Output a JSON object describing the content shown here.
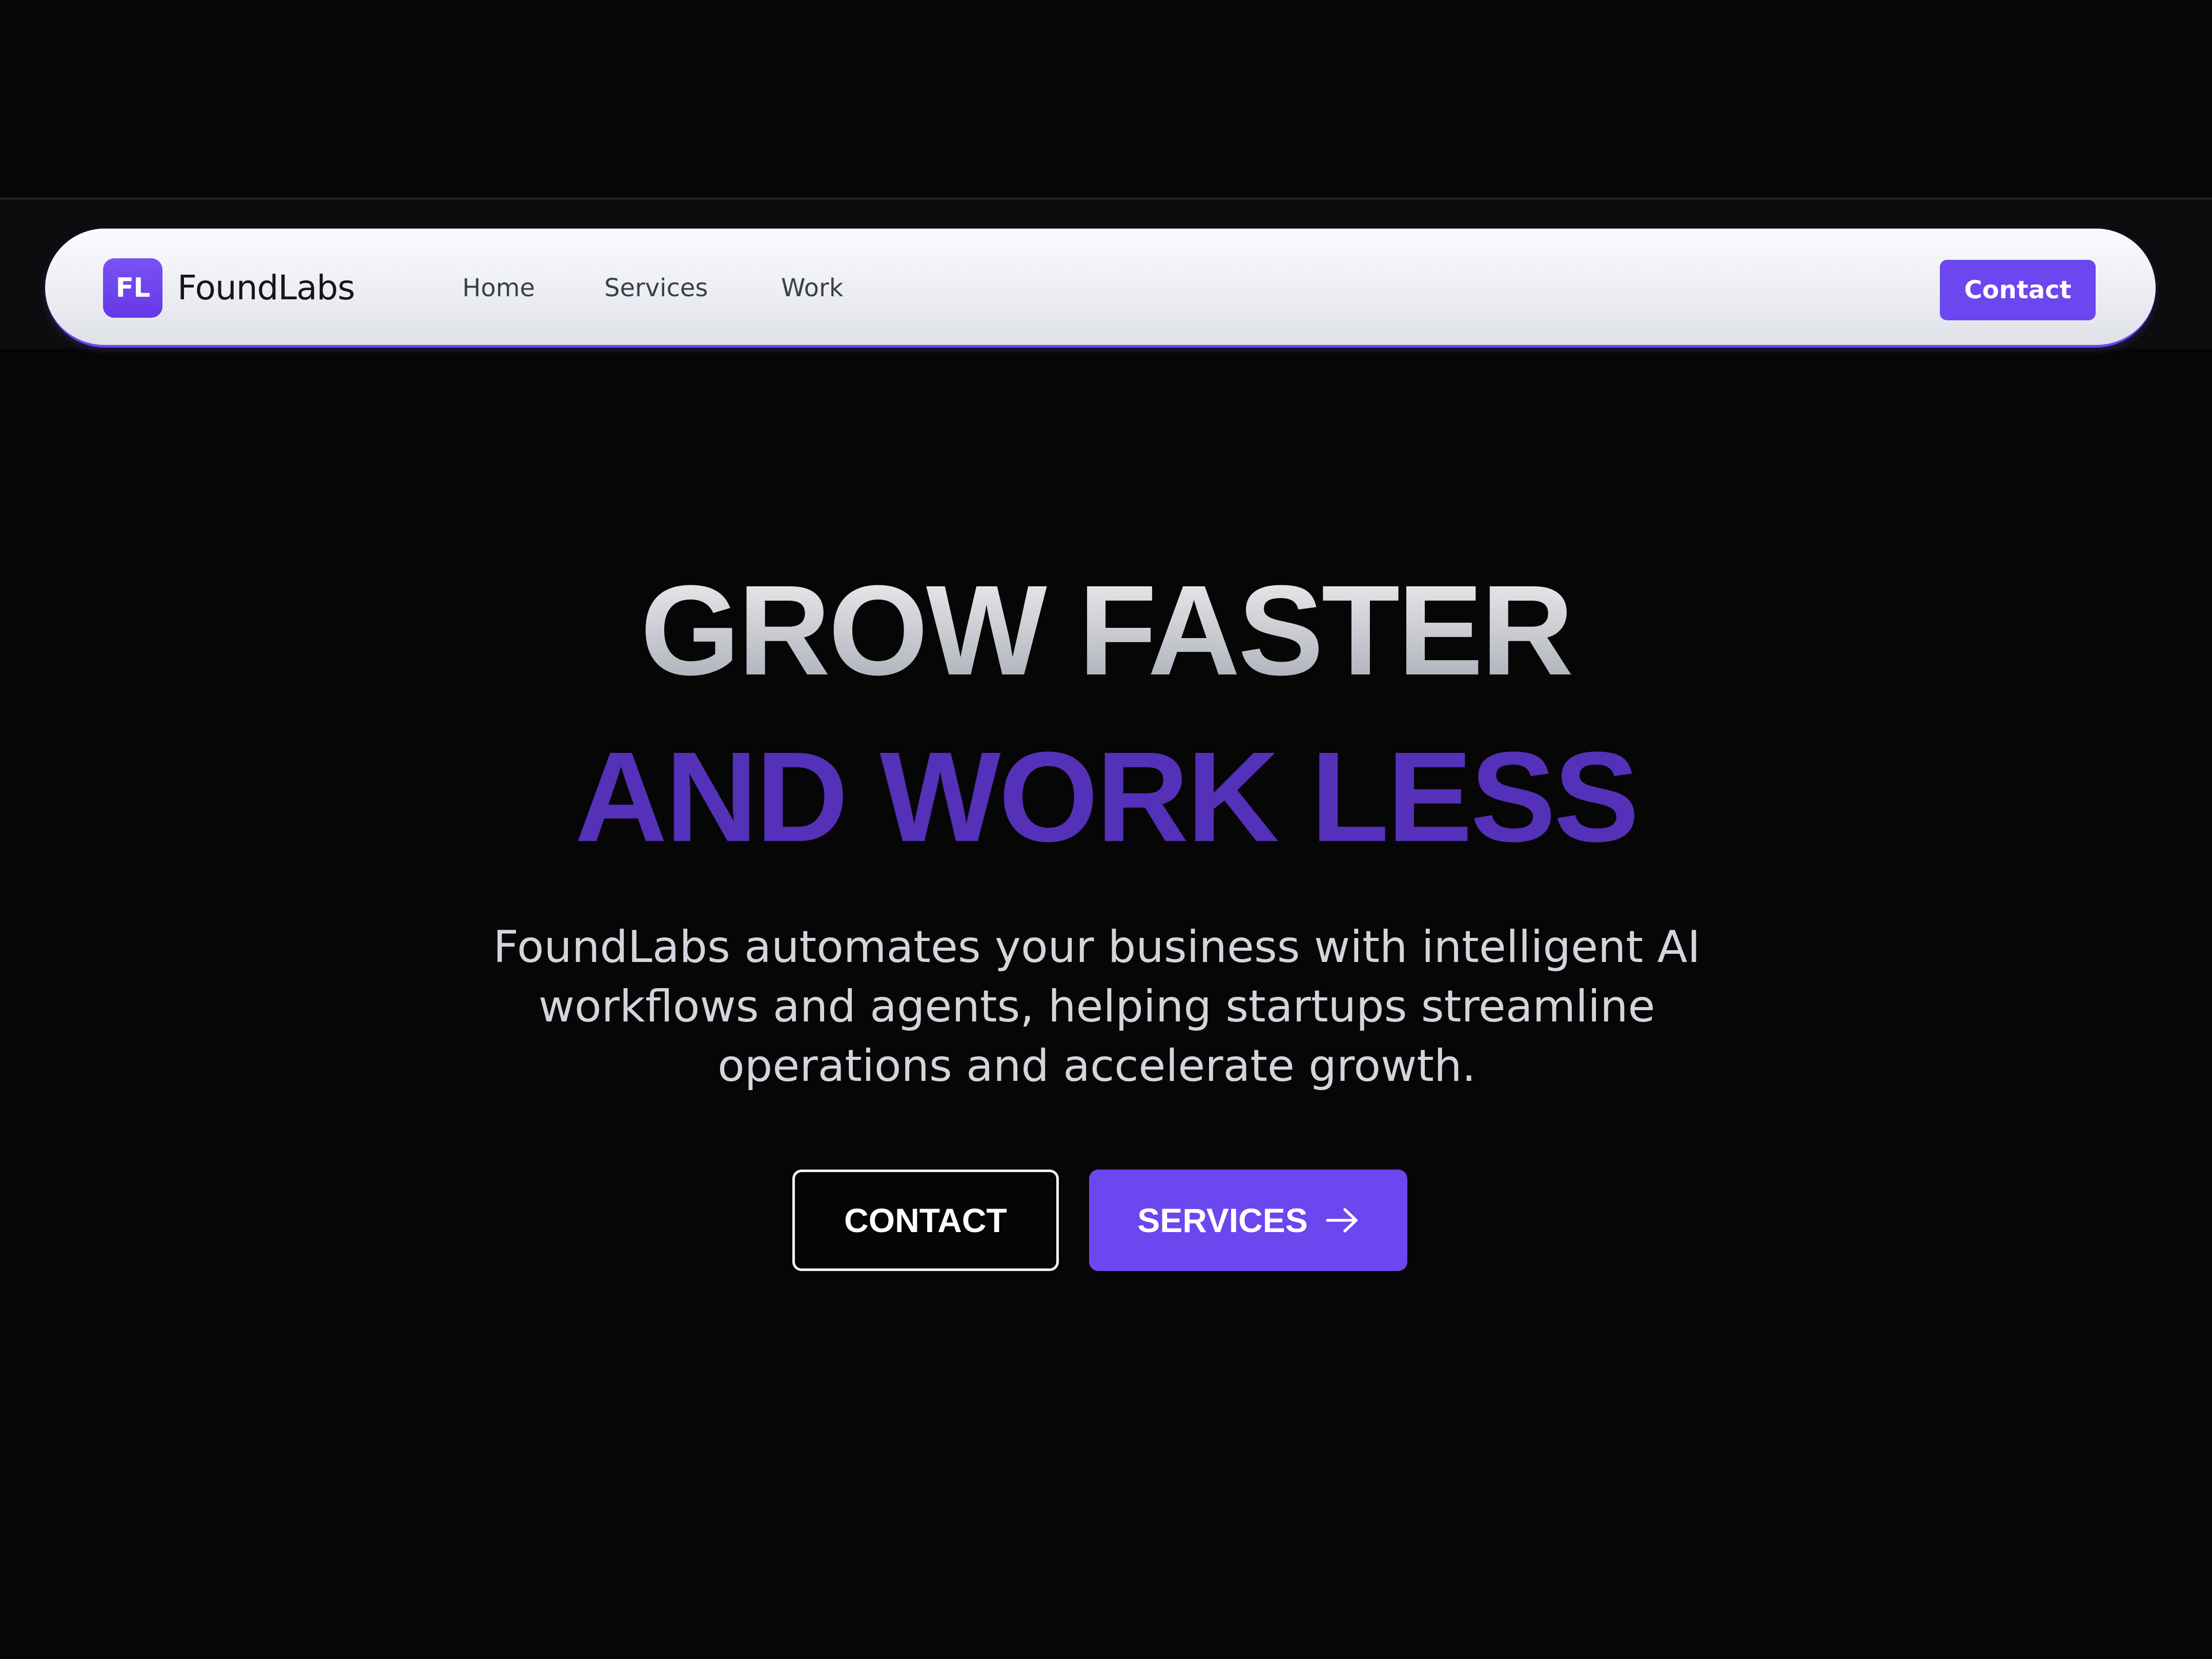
{
  "colors": {
    "background": "#060606",
    "accent": "#6c46ee",
    "headline_accent": "#5530b8",
    "navbar": "#f3f4f7"
  },
  "nav": {
    "logo_initials": "FL",
    "brand": "FoundLabs",
    "links": [
      {
        "label": "Home"
      },
      {
        "label": "Services"
      },
      {
        "label": "Work"
      }
    ],
    "contact_label": "Contact"
  },
  "hero": {
    "headline_line1": "GROW FASTER",
    "headline_line2": "AND WORK LESS",
    "subtitle": "FoundLabs automates your business with intelligent AI workflows and agents, helping startups streamline operations and accelerate growth.",
    "contact_button": "CONTACT",
    "services_button": "SERVICES",
    "services_button_icon": "arrow-right-icon"
  }
}
